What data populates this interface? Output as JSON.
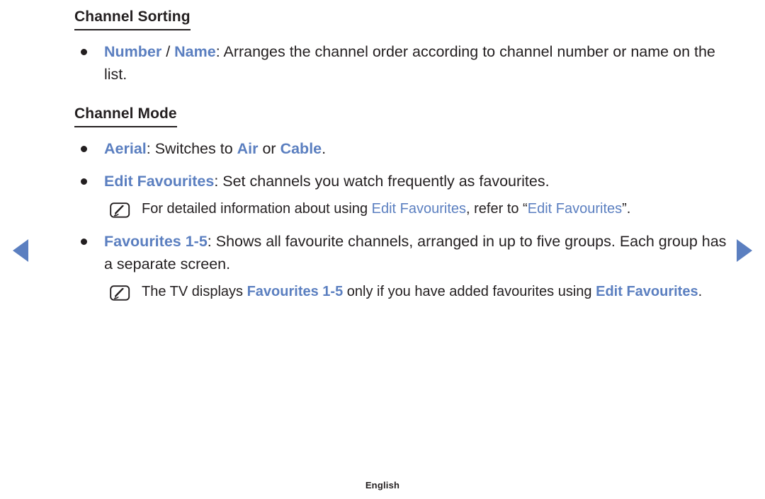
{
  "nav": {
    "prev_label": "Previous page",
    "next_label": "Next page"
  },
  "sections": [
    {
      "heading": "Channel Sorting",
      "bullets": [
        {
          "parts": [
            {
              "text": "Number",
              "style": "kw"
            },
            {
              "text": " / ",
              "style": "sep"
            },
            {
              "text": "Name",
              "style": "kw"
            },
            {
              "text": ": Arranges the channel order according to channel number or name on the list.",
              "style": "plain"
            }
          ]
        }
      ],
      "notes": []
    },
    {
      "heading": "Channel Mode",
      "bullets": [
        {
          "parts": [
            {
              "text": "Aerial",
              "style": "kw"
            },
            {
              "text": ": Switches to ",
              "style": "plain"
            },
            {
              "text": "Air",
              "style": "kw"
            },
            {
              "text": " or ",
              "style": "plain"
            },
            {
              "text": "Cable",
              "style": "kw"
            },
            {
              "text": ".",
              "style": "plain"
            }
          ],
          "notes": []
        },
        {
          "parts": [
            {
              "text": "Edit Favourites",
              "style": "kw"
            },
            {
              "text": ": Set channels you watch frequently as favourites.",
              "style": "plain"
            }
          ],
          "notes": [
            {
              "icon": "note-pencil-icon",
              "parts": [
                {
                  "text": "For detailed information about using ",
                  "style": "plain"
                },
                {
                  "text": "Edit Favourites",
                  "style": "kw-reg"
                },
                {
                  "text": ", refer to “",
                  "style": "plain"
                },
                {
                  "text": "Edit Favourites",
                  "style": "kw-reg"
                },
                {
                  "text": "”.",
                  "style": "plain"
                }
              ]
            }
          ]
        },
        {
          "parts": [
            {
              "text": "Favourites 1-5",
              "style": "kw"
            },
            {
              "text": ": Shows all favourite channels, arranged in up to five groups. Each group has a separate screen.",
              "style": "plain"
            }
          ],
          "notes": [
            {
              "icon": "note-pencil-icon",
              "parts": [
                {
                  "text": "The TV displays ",
                  "style": "plain"
                },
                {
                  "text": "Favourites 1-5",
                  "style": "kw"
                },
                {
                  "text": " only if you have added favourites using ",
                  "style": "plain"
                },
                {
                  "text": "Edit Favourites",
                  "style": "kw"
                },
                {
                  "text": ".",
                  "style": "plain"
                }
              ]
            }
          ]
        }
      ]
    }
  ],
  "footer": {
    "language": "English"
  },
  "colors": {
    "accent_blue": "#5b7fc0",
    "text_dark": "#231f20",
    "background": "#ffffff"
  }
}
